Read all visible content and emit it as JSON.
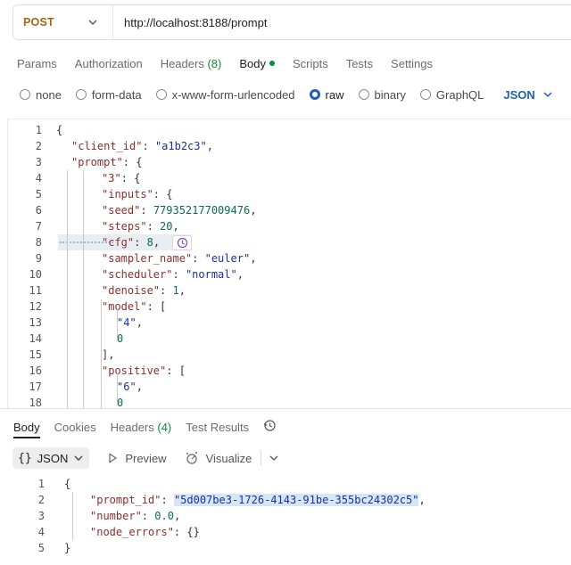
{
  "request": {
    "method": "POST",
    "url": "http://localhost:8188/prompt"
  },
  "req_tabs": [
    {
      "label": "Params"
    },
    {
      "label": "Authorization"
    },
    {
      "label": "Headers",
      "count": "(8)"
    },
    {
      "label": "Body",
      "active": true,
      "dot": true
    },
    {
      "label": "Scripts"
    },
    {
      "label": "Tests"
    },
    {
      "label": "Settings"
    }
  ],
  "body_types": [
    "none",
    "form-data",
    "x-www-form-urlencoded",
    "raw",
    "binary",
    "GraphQL"
  ],
  "body_type_selected": "raw",
  "body_format": "JSON",
  "request_body_lines": [
    {
      "n": "1",
      "indent": 0,
      "tokens": [
        [
          "p",
          "{"
        ]
      ]
    },
    {
      "n": "2",
      "indent": 1,
      "tokens": [
        [
          "k",
          "\"client_id\""
        ],
        [
          "p",
          ": "
        ],
        [
          "s",
          "\"a1b2c3\""
        ],
        [
          "p",
          ","
        ]
      ]
    },
    {
      "n": "3",
      "indent": 1,
      "tokens": [
        [
          "k",
          "\"prompt\""
        ],
        [
          "p",
          ": {"
        ]
      ]
    },
    {
      "n": "4",
      "indent": 3,
      "tokens": [
        [
          "k",
          "\"3\""
        ],
        [
          "p",
          ": {"
        ]
      ]
    },
    {
      "n": "5",
      "indent": 3,
      "tokens": [
        [
          "k",
          "\"inputs\""
        ],
        [
          "p",
          ": {"
        ]
      ]
    },
    {
      "n": "6",
      "indent": 3,
      "tokens": [
        [
          "k",
          "\"seed\""
        ],
        [
          "p",
          ": "
        ],
        [
          "n",
          "779352177009476"
        ],
        [
          "p",
          ","
        ]
      ]
    },
    {
      "n": "7",
      "indent": 3,
      "tokens": [
        [
          "k",
          "\"steps\""
        ],
        [
          "p",
          ": "
        ],
        [
          "n",
          "20"
        ],
        [
          "p",
          ","
        ]
      ]
    },
    {
      "n": "8",
      "indent": 3,
      "tokens": [
        [
          "k",
          "\"cfg\""
        ],
        [
          "p",
          ": "
        ],
        [
          "n",
          "8"
        ],
        [
          "p",
          ","
        ]
      ]
    },
    {
      "n": "9",
      "indent": 3,
      "tokens": [
        [
          "k",
          "\"sampler_name\""
        ],
        [
          "p",
          ": "
        ],
        [
          "s",
          "\"euler\""
        ],
        [
          "p",
          ","
        ]
      ]
    },
    {
      "n": "10",
      "indent": 3,
      "tokens": [
        [
          "k",
          "\"scheduler\""
        ],
        [
          "p",
          ": "
        ],
        [
          "s",
          "\"normal\""
        ],
        [
          "p",
          ","
        ]
      ]
    },
    {
      "n": "11",
      "indent": 3,
      "tokens": [
        [
          "k",
          "\"denoise\""
        ],
        [
          "p",
          ": "
        ],
        [
          "n",
          "1"
        ],
        [
          "p",
          ","
        ]
      ]
    },
    {
      "n": "12",
      "indent": 3,
      "tokens": [
        [
          "k",
          "\"model\""
        ],
        [
          "p",
          ": ["
        ]
      ]
    },
    {
      "n": "13",
      "indent": 4,
      "tokens": [
        [
          "s",
          "\"4\""
        ],
        [
          "p",
          ","
        ]
      ]
    },
    {
      "n": "14",
      "indent": 4,
      "tokens": [
        [
          "n",
          "0"
        ]
      ]
    },
    {
      "n": "15",
      "indent": 3,
      "tokens": [
        [
          "p",
          "],"
        ]
      ]
    },
    {
      "n": "16",
      "indent": 3,
      "tokens": [
        [
          "k",
          "\"positive\""
        ],
        [
          "p",
          ": ["
        ]
      ]
    },
    {
      "n": "17",
      "indent": 4,
      "tokens": [
        [
          "s",
          "\"6\""
        ],
        [
          "p",
          ","
        ]
      ]
    },
    {
      "n": "18",
      "indent": 4,
      "tokens": [
        [
          "n",
          "0"
        ]
      ]
    }
  ],
  "resp_tabs": [
    {
      "label": "Body",
      "active": true
    },
    {
      "label": "Cookies"
    },
    {
      "label": "Headers",
      "count": "(4)"
    },
    {
      "label": "Test Results"
    }
  ],
  "resp_toolbar": {
    "format_brace": "{}",
    "format": "JSON",
    "preview": "Preview",
    "visualize": "Visualize"
  },
  "response_lines": [
    {
      "n": "1",
      "indent": 0,
      "tokens": [
        [
          "p",
          "{"
        ]
      ]
    },
    {
      "n": "2",
      "indent": 1,
      "tokens": [
        [
          "k",
          "\"prompt_id\""
        ],
        [
          "p",
          ": "
        ],
        [
          "s",
          "\"5d007be3-1726-4143-91be-355bc24302c5\"",
          "sel"
        ],
        [
          "p",
          ","
        ]
      ]
    },
    {
      "n": "3",
      "indent": 1,
      "tokens": [
        [
          "k",
          "\"number\""
        ],
        [
          "p",
          ": "
        ],
        [
          "n",
          "0.0"
        ],
        [
          "p",
          ","
        ]
      ]
    },
    {
      "n": "4",
      "indent": 1,
      "tokens": [
        [
          "k",
          "\"node_errors\""
        ],
        [
          "p",
          ": {}"
        ]
      ]
    },
    {
      "n": "5",
      "indent": 0,
      "tokens": [
        [
          "p",
          "}"
        ]
      ]
    }
  ],
  "colors": {
    "method": "#a8631a",
    "accent": "#1f5fb8",
    "active_dot": "#0c8a3f"
  }
}
